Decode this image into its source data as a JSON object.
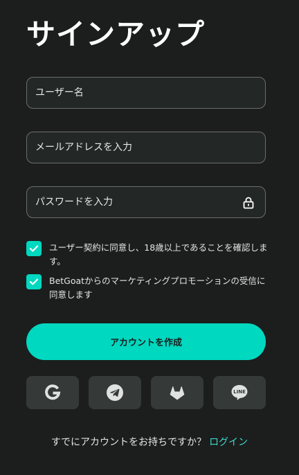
{
  "title": "サインアップ",
  "form": {
    "username_placeholder": "ユーザー名",
    "email_placeholder": "メールアドレスを入力",
    "password_placeholder": "パスワードを入力"
  },
  "agreements": [
    {
      "label": "ユーザー契約に同意し、18歳以上であることを確認します。",
      "checked": true
    },
    {
      "label": "BetGoatからのマーケティングプロモーションの受信に同意します",
      "checked": true
    }
  ],
  "create_button_label": "アカウントを作成",
  "social_logins": [
    {
      "icon": "google-icon"
    },
    {
      "icon": "telegram-icon"
    },
    {
      "icon": "gitlab-icon"
    },
    {
      "icon": "line-icon",
      "text": "LINE"
    }
  ],
  "footer": {
    "prompt": "すでにアカウントをお持ちですか？",
    "login_link": "ログイン"
  },
  "colors": {
    "background": "#1b1e1d",
    "accent": "#00d8c0",
    "input_bg": "#232726",
    "social_bg": "#353938",
    "link": "#3fd9cc"
  }
}
